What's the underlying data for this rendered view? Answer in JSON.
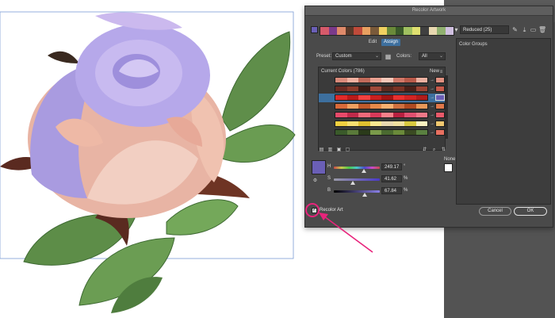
{
  "dialog": {
    "title": "Recolor Artwork",
    "harmony_name": "Reduced (25)",
    "tabs": {
      "edit": "Edit",
      "assign": "Assign"
    },
    "preset_label": "Preset:",
    "preset_value": "Custom",
    "colors_label": "Colors:",
    "colors_value": "All",
    "current_colors_label": "Current Colors (786)",
    "new_label": "New",
    "color_groups_label": "Color Groups",
    "none_label": "None",
    "hsb": {
      "h_label": "H",
      "h_value": "249.17",
      "h_unit": "°",
      "s_label": "S",
      "s_value": "41.62",
      "s_unit": "%",
      "b_label": "B",
      "b_value": "67.84",
      "b_unit": "%"
    },
    "cancel_label": "Cancel",
    "ok_label": "OK",
    "recolor_art_label": "Recolor Art",
    "recolor_art_checked": true,
    "accent_color": "#3d6f9e",
    "selected_color": "#6a5fb6",
    "annotation_color": "#e8237b"
  }
}
